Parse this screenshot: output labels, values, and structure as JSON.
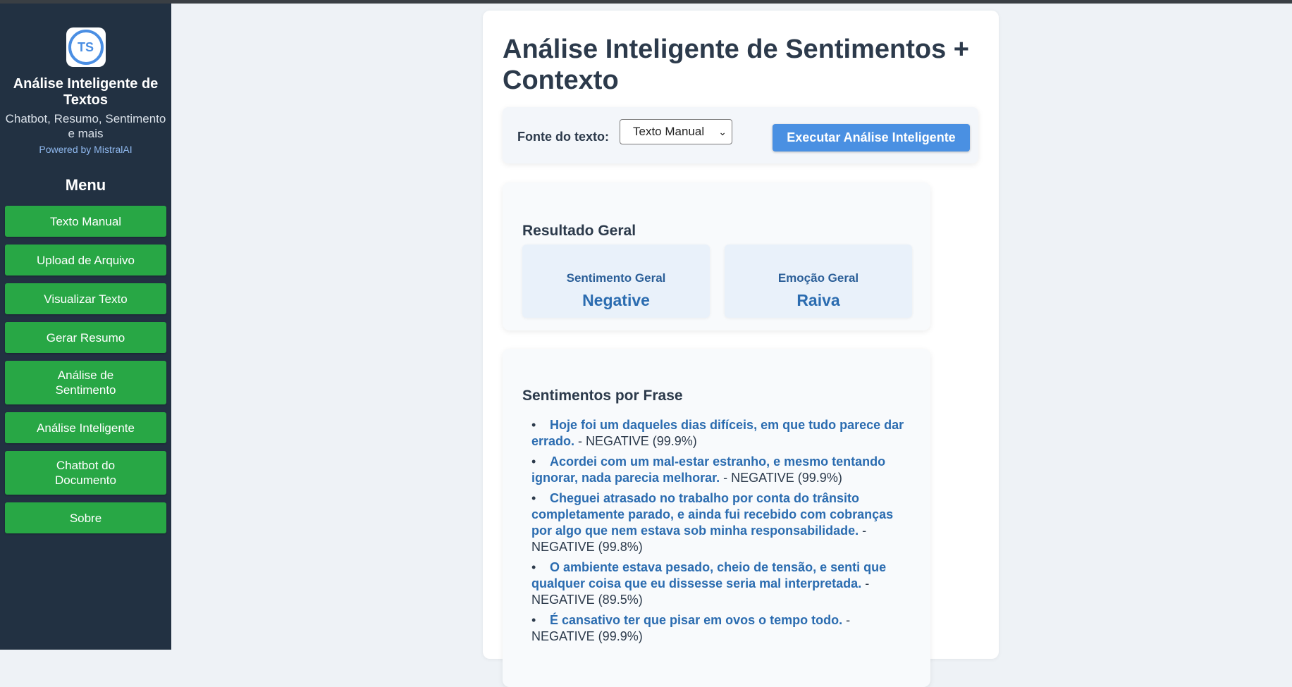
{
  "sidebar": {
    "logo_text": "TS",
    "app_title": "Análise Inteligente de Textos",
    "app_subtitle": "Chatbot, Resumo, Sentimento e mais",
    "powered_by": "Powered by MistralAI",
    "menu_title": "Menu",
    "items": [
      {
        "label": "Texto Manual"
      },
      {
        "label": "Upload de Arquivo"
      },
      {
        "label": "Visualizar Texto"
      },
      {
        "label": "Gerar Resumo"
      },
      {
        "label": "Análise de Sentimento"
      },
      {
        "label": "Análise Inteligente"
      },
      {
        "label": "Chatbot do Documento"
      },
      {
        "label": "Sobre"
      }
    ],
    "button_color": "#28a745"
  },
  "main": {
    "title": "Análise Inteligente de Sentimentos + Contexto",
    "source_label": "Fonte do texto:",
    "source_select_value": "Texto Manual",
    "run_button_label": "Executar Análise Inteligente",
    "accent_color": "#4a90e2",
    "overall": {
      "title": "Resultado Geral",
      "sentiment_label": "Sentimento Geral",
      "sentiment_value": "Negative",
      "emotion_label": "Emoção Geral",
      "emotion_value": "Raiva"
    },
    "sentences": {
      "title": "Sentimentos por Frase",
      "items": [
        {
          "text": "Hoje foi um daqueles dias difíceis, em que tudo parece dar errado.",
          "result": " - NEGATIVE (99.9%)"
        },
        {
          "text": "Acordei com um mal-estar estranho, e mesmo tentando ignorar, nada parecia melhorar.",
          "result": " - NEGATIVE (99.9%)"
        },
        {
          "text": "Cheguei atrasado no trabalho por conta do trânsito completamente parado, e ainda fui recebido com cobranças por algo que nem estava sob minha responsabilidade.",
          "result": " - NEGATIVE (99.8%)"
        },
        {
          "text": "O ambiente estava pesado, cheio de tensão, e senti que qualquer coisa que eu dissesse seria mal interpretada.",
          "result": " - NEGATIVE (89.5%)"
        },
        {
          "text": "É cansativo ter que pisar em ovos o tempo todo.",
          "result": " - NEGATIVE (99.9%)"
        }
      ]
    }
  }
}
